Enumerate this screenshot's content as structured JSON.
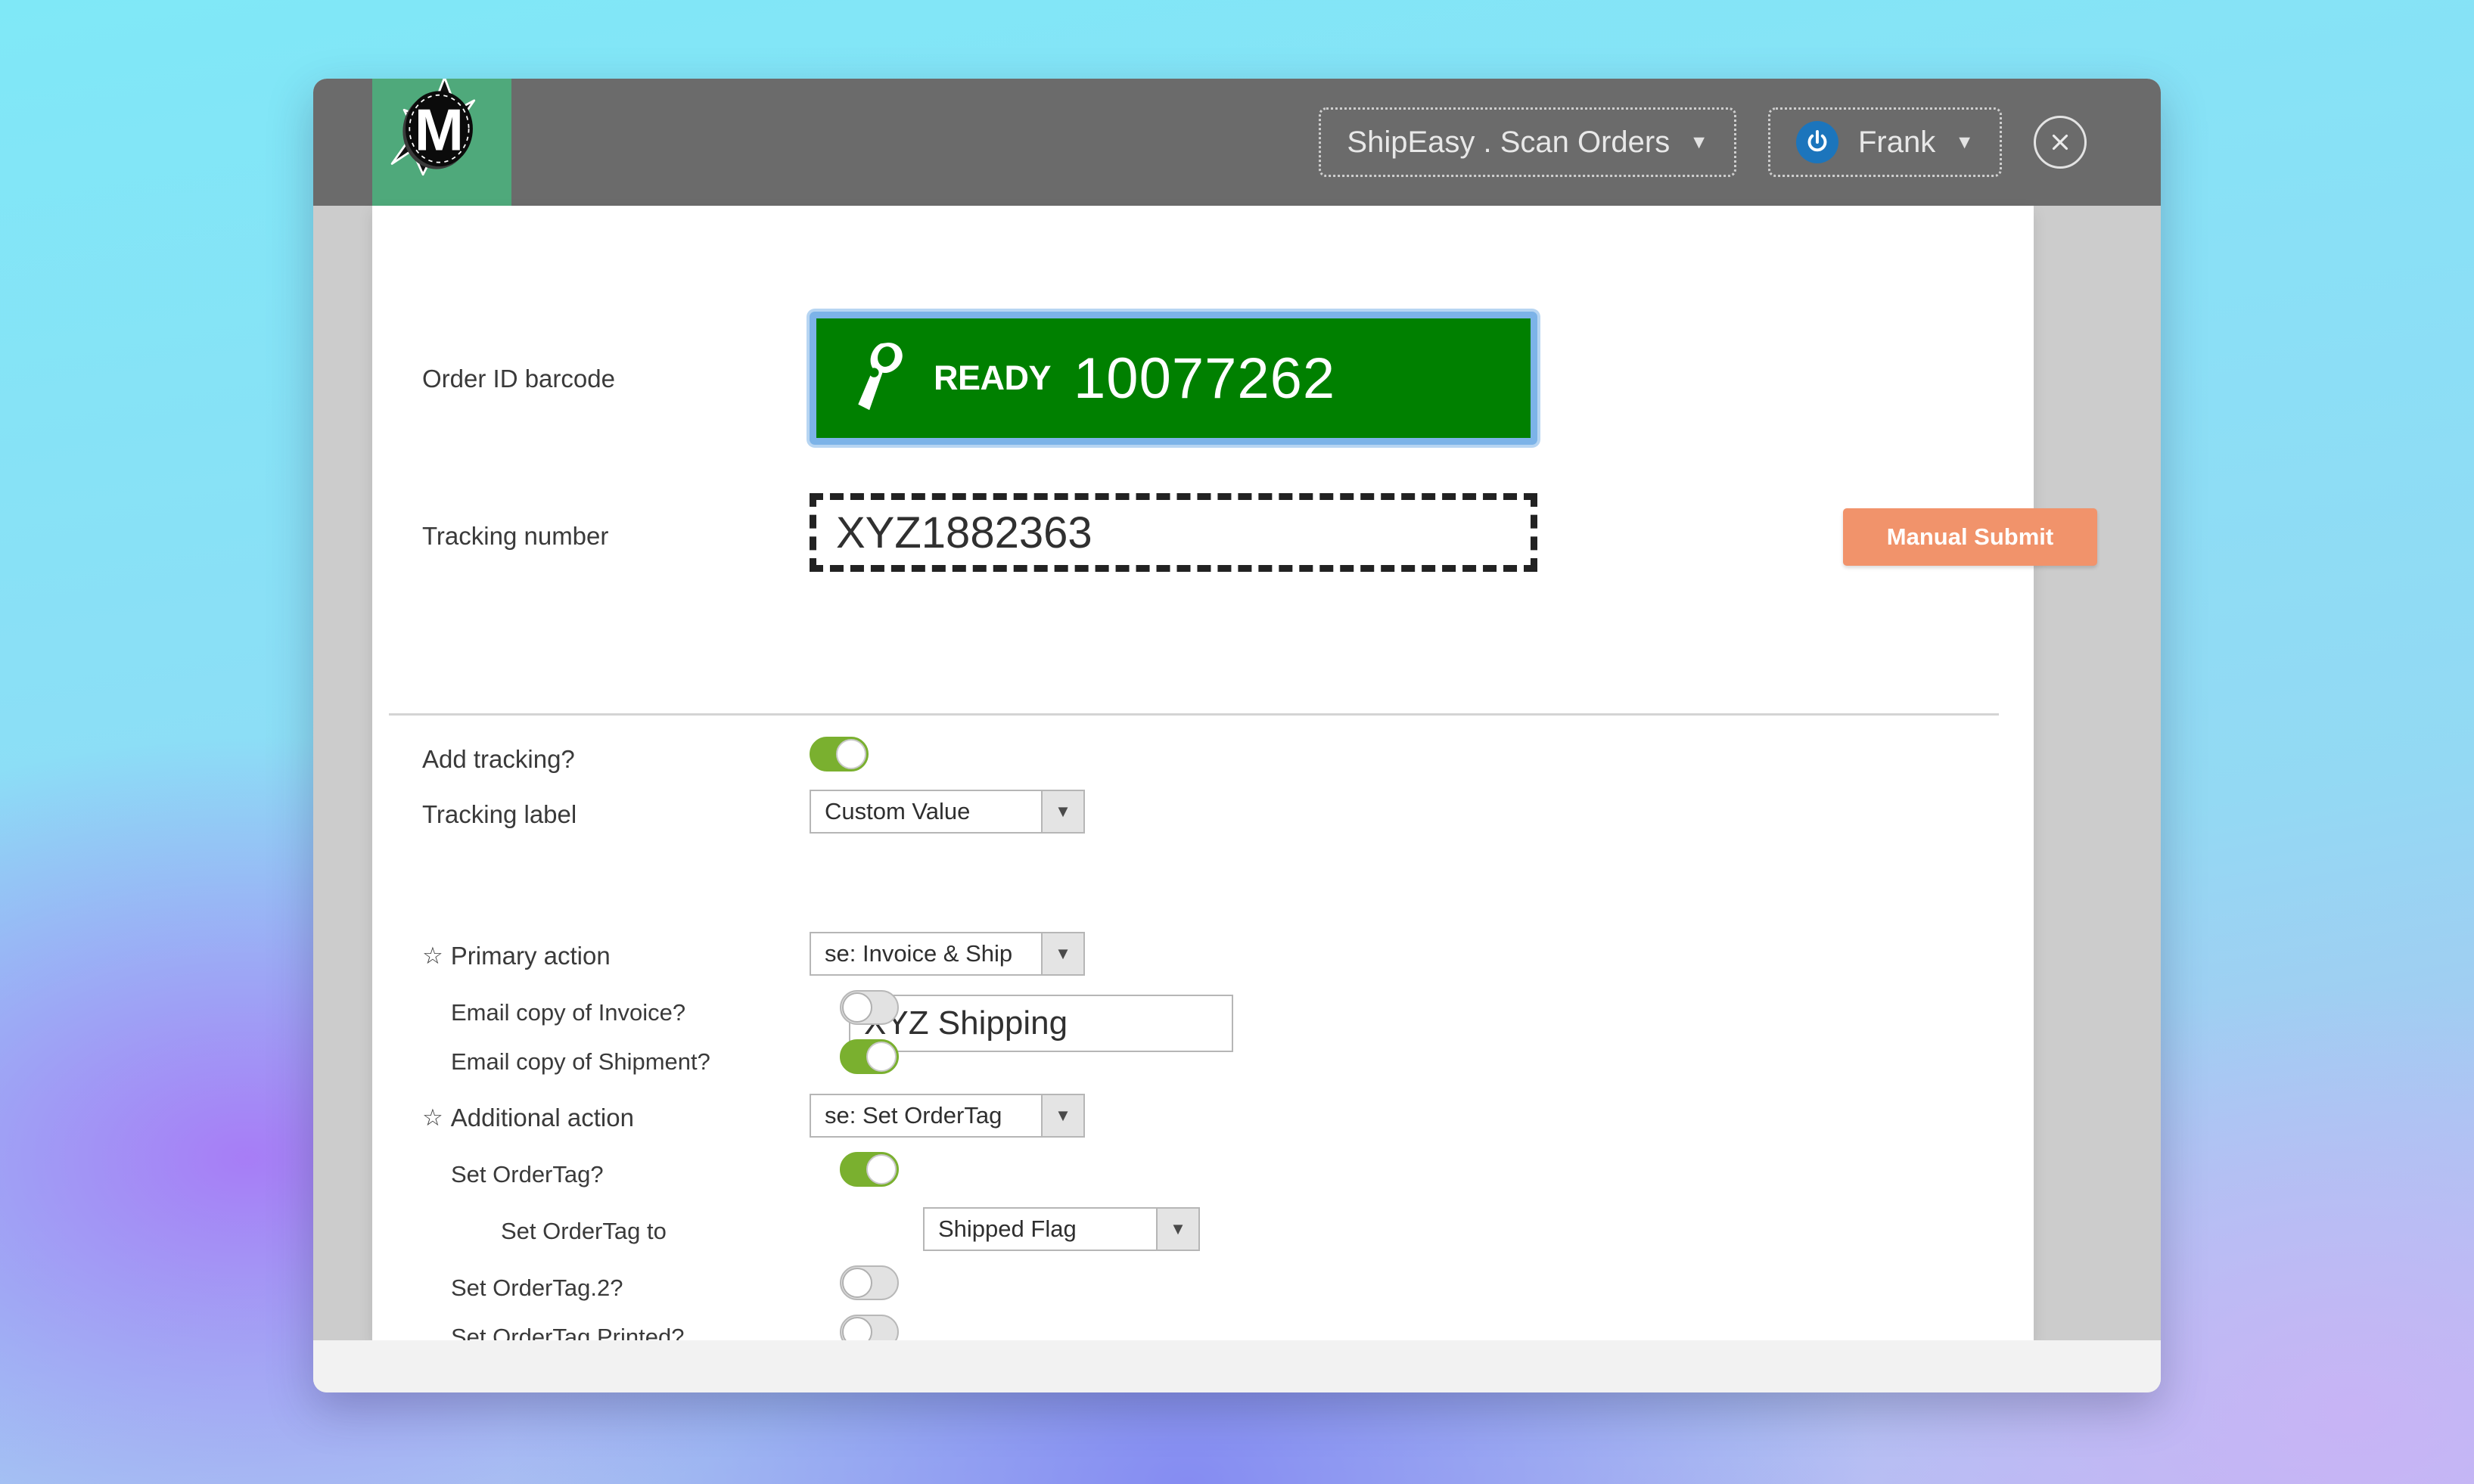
{
  "titlebar": {
    "logo_alt": "lightning-m-logo",
    "app_selector": "ShipEasy . Scan Orders",
    "user_name": "Frank",
    "caret": "▼",
    "close_label": "✕",
    "power_icon": "power-icon"
  },
  "form": {
    "order_barcode": {
      "label": "Order ID barcode",
      "status": "READY",
      "value": "10077262",
      "icon": "barcode-scanner-icon"
    },
    "tracking_number": {
      "label": "Tracking number",
      "value": "XYZ1882363",
      "placeholder": ""
    },
    "manual_submit": "Manual Submit",
    "add_tracking": {
      "label": "Add tracking?",
      "state": "on"
    },
    "tracking_label": {
      "label": "Tracking label",
      "value": "Custom Value"
    },
    "tracking_custom_value": {
      "value": "XYZ Shipping",
      "placeholder": ""
    },
    "primary_action": {
      "star": "☆",
      "label": "Primary action",
      "value": "se: Invoice & Ship"
    },
    "email_invoice": {
      "label": "Email copy of Invoice?",
      "state": "off"
    },
    "email_shipment": {
      "label": "Email copy of Shipment?",
      "state": "on"
    },
    "additional_action": {
      "star": "☆",
      "label": "Additional action",
      "value": "se: Set OrderTag"
    },
    "set_ordertag": {
      "label": "Set OrderTag?",
      "state": "on"
    },
    "set_ordertag_to": {
      "label": "Set OrderTag to",
      "value": "Shipped Flag"
    },
    "set_ordertag_2": {
      "label": "Set OrderTag.2?",
      "state": "off"
    },
    "set_ordertag_printed": {
      "label": "Set OrderTag.Printed?",
      "state": "off"
    }
  },
  "colors": {
    "ready_green": "#008000",
    "focus_blue": "#7cb3e8",
    "toggle_on": "#7ab02f",
    "submit_salmon": "#f1936b",
    "titlebar_gray": "#6b6b6b",
    "logo_green": "#4fa97b"
  }
}
